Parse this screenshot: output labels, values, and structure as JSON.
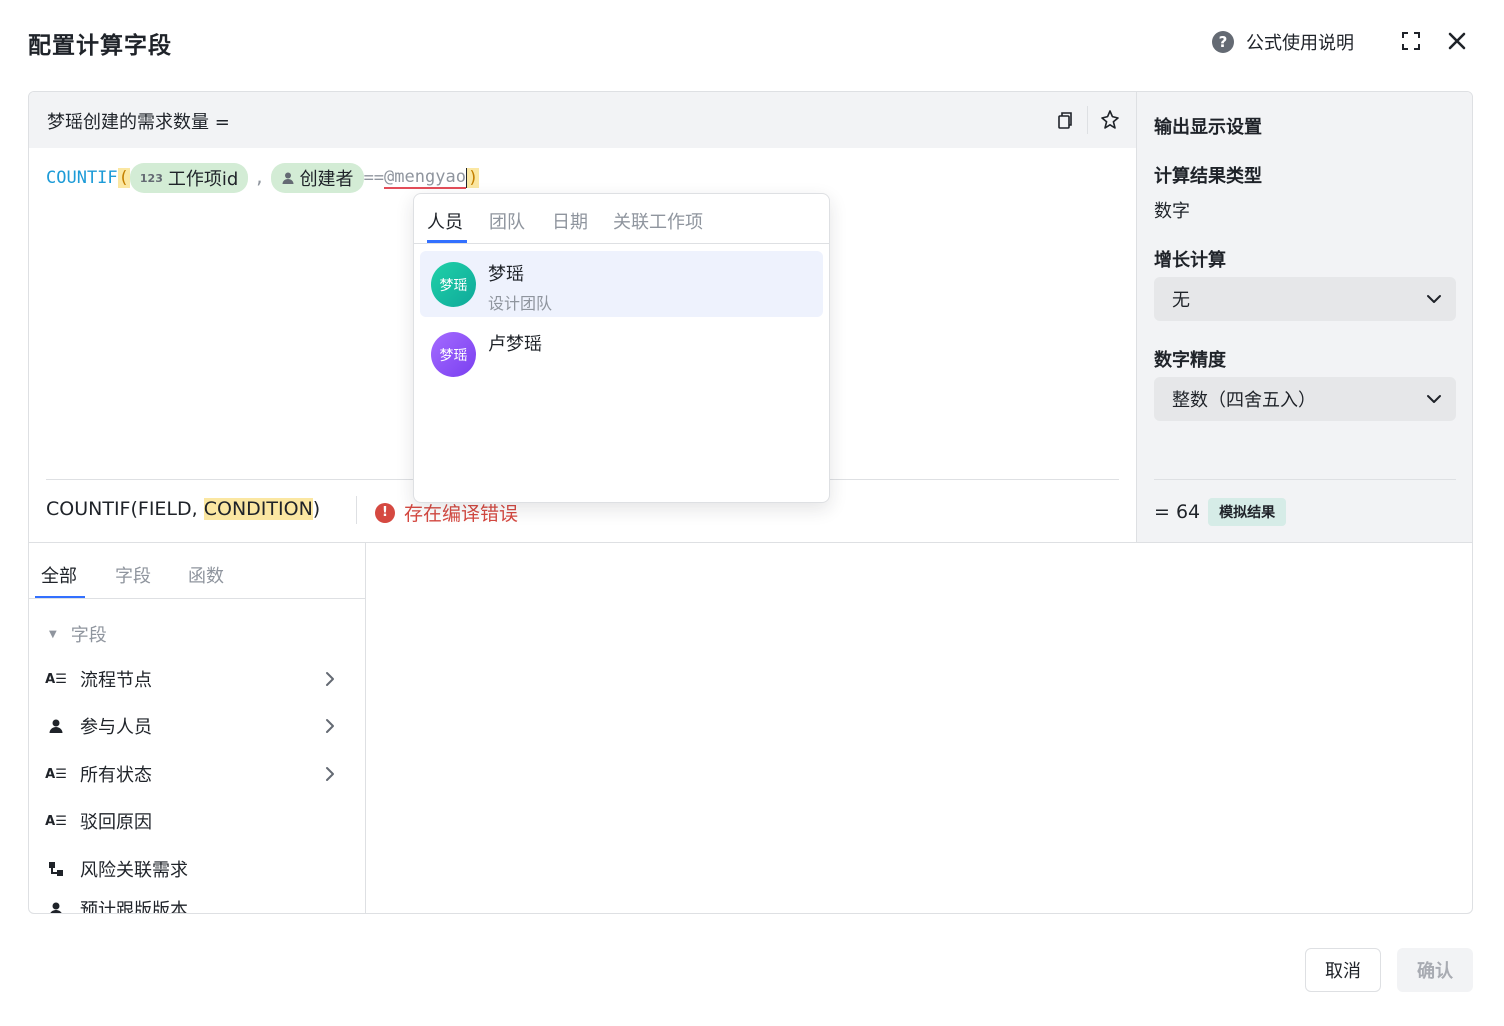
{
  "dialog": {
    "title": "配置计算字段",
    "help_label": "公式使用说明"
  },
  "editor": {
    "title": "梦瑶创建的需求数量 =",
    "formula": {
      "function": "COUNTIF",
      "open_paren": "(",
      "chip1_icon": "123",
      "chip1_label": "工作项id",
      "comma": ",",
      "chip2_label": "创建者",
      "operator": "==",
      "mention": "@mengyao",
      "close_paren": ")"
    },
    "syntax": {
      "prefix": "COUNTIF(FIELD, ",
      "highlight": "CONDITION",
      "suffix": ")"
    },
    "error_text": "存在编译错误"
  },
  "side": {
    "title": "输出显示设置",
    "result_type_label": "计算结果类型",
    "result_type_value": "数字",
    "growth_label": "增长计算",
    "growth_value": "无",
    "precision_label": "数字精度",
    "precision_value": "整数（四舍五入）",
    "result_value": "= 64",
    "result_badge": "模拟结果"
  },
  "library": {
    "tabs": [
      "全部",
      "字段",
      "函数"
    ],
    "active_tab": 0,
    "group_label": "字段",
    "items": [
      {
        "label": "流程节点",
        "icon": "text-field-icon",
        "has_children": true
      },
      {
        "label": "参与人员",
        "icon": "person-icon",
        "has_children": true
      },
      {
        "label": "所有状态",
        "icon": "text-field-icon",
        "has_children": true
      },
      {
        "label": "驳回原因",
        "icon": "text-field-icon",
        "has_children": false
      },
      {
        "label": "风险关联需求",
        "icon": "relation-icon",
        "has_children": false
      },
      {
        "label": "预计跟版版本",
        "icon": "person-icon",
        "has_children": false
      }
    ]
  },
  "dropdown": {
    "tabs": [
      "人员",
      "团队",
      "日期",
      "关联工作项"
    ],
    "active_tab": 0,
    "items": [
      {
        "avatar": "梦瑶",
        "name": "梦瑶",
        "team": "设计团队",
        "selected": true,
        "color": "#14c0a4"
      },
      {
        "avatar": "梦瑶",
        "name": "卢梦瑶",
        "team": "",
        "selected": false,
        "color": "#8a4fff"
      }
    ]
  },
  "footer": {
    "cancel_label": "取消",
    "confirm_label": "确认"
  },
  "colors": {
    "accent": "#3370ff",
    "error": "#d54941",
    "function": "#1d9bd7",
    "chip": "#d3ecd5",
    "highlight": "#fbe7a2"
  }
}
